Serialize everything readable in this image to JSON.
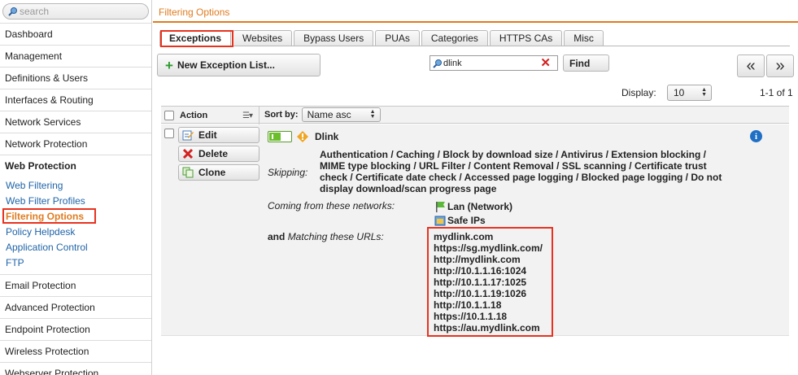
{
  "sidebar": {
    "search_placeholder": "search",
    "items_top": [
      {
        "label": "Dashboard"
      },
      {
        "label": "Management"
      },
      {
        "label": "Definitions & Users"
      },
      {
        "label": "Interfaces & Routing"
      },
      {
        "label": "Network Services"
      },
      {
        "label": "Network Protection"
      }
    ],
    "section": {
      "label": "Web Protection"
    },
    "sub_items": [
      {
        "label": "Web Filtering"
      },
      {
        "label": "Web Filter Profiles"
      },
      {
        "label": "Filtering Options",
        "active": true
      },
      {
        "label": "Policy Helpdesk"
      },
      {
        "label": "Application Control"
      },
      {
        "label": "FTP"
      }
    ],
    "items_bottom": [
      {
        "label": "Email Protection"
      },
      {
        "label": "Advanced Protection"
      },
      {
        "label": "Endpoint Protection"
      },
      {
        "label": "Wireless Protection"
      },
      {
        "label": "Webserver Protection"
      }
    ]
  },
  "header": {
    "title": "Filtering Options"
  },
  "tabs": [
    {
      "label": "Exceptions",
      "active": true
    },
    {
      "label": "Websites"
    },
    {
      "label": "Bypass Users"
    },
    {
      "label": "PUAs"
    },
    {
      "label": "Categories"
    },
    {
      "label": "HTTPS CAs"
    },
    {
      "label": "Misc"
    }
  ],
  "toolbar": {
    "new_button": "New Exception List...",
    "find_value": "dlink",
    "find_button": "Find",
    "prev": "«",
    "next": "»",
    "display_label": "Display:",
    "display_value": "10",
    "range": "1-1 of 1"
  },
  "table": {
    "action_header": "Action",
    "sort_label": "Sort by:",
    "sort_value": "Name asc"
  },
  "entry": {
    "name": "Dlink",
    "actions": {
      "edit": "Edit",
      "delete": "Delete",
      "clone": "Clone"
    },
    "skipping_label": "Skipping:",
    "skipping_text": "Authentication / Caching / Block by download size / Antivirus / Extension blocking / MIME type blocking / URL Filter / Content Removal / SSL scanning / Certificate trust check / Certificate date check / Accessed page logging / Blocked page logging / Do not display download/scan progress page",
    "networks_label": "Coming from these networks:",
    "networks": [
      "Lan (Network)",
      "Safe IPs"
    ],
    "urls_label_bold": "and",
    "urls_label_italic": "Matching these URLs:",
    "urls": [
      "mydlink.com",
      "https://sg.mydlink.com/",
      "http://mydlink.com",
      "http://10.1.1.16:1024",
      "http://10.1.1.17:1025",
      "http://10.1.1.19:1026",
      "http://10.1.1.18",
      "https://10.1.1.18",
      "https://au.mydlink.com"
    ]
  },
  "colors": {
    "accent": "#e07b1e",
    "link": "#1f64a8",
    "highlight": "#e8321f",
    "toggle_on": "#6bbf2a",
    "info": "#1f6fc5"
  }
}
